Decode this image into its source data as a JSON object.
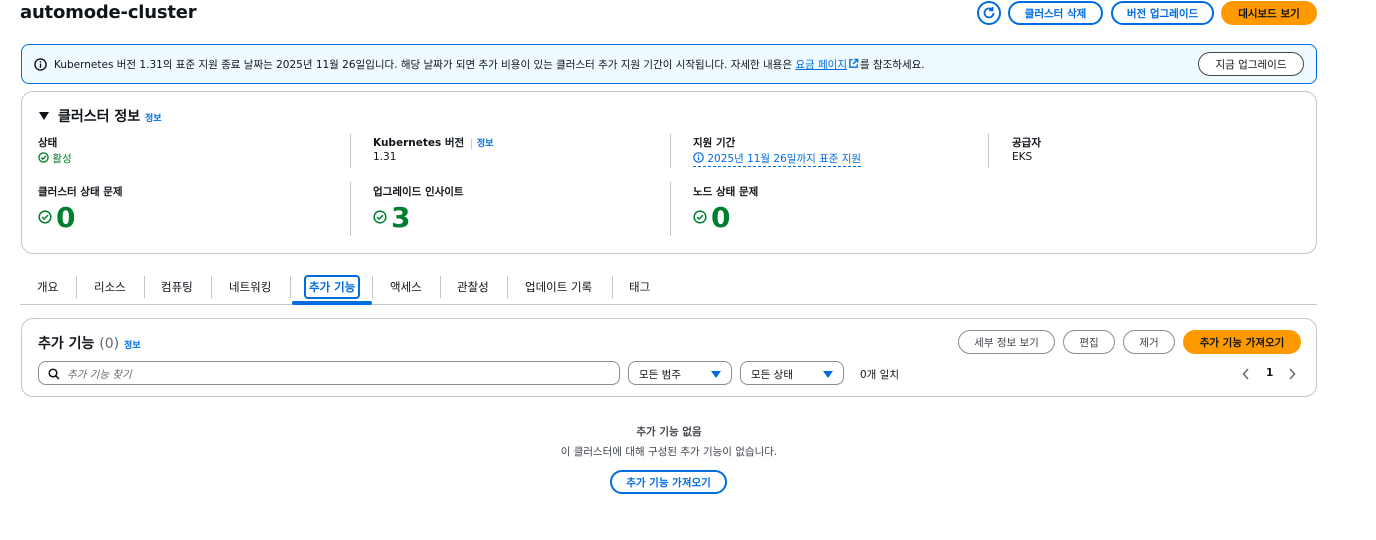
{
  "header": {
    "title": "automode-cluster",
    "delete_label": "클러스터 삭제",
    "upgrade_label": "버전 업그레이드",
    "dashboard_label": "대시보드 보기"
  },
  "alert": {
    "text_before": "Kubernetes 버전 1.31의 표준 지원 종료 날짜는 2025년 11월 26일입니다. 해당 날짜가 되면 추가 비용이 있는 클러스터 추가 지원 기간이 시작됩니다. 자세한 내용은 ",
    "link": "요금 페이지",
    "text_after": "를 참조하세요.",
    "button": "지금 업그레이드"
  },
  "cluster_info": {
    "title": "클러스터 정보",
    "info": "정보",
    "status_label": "상태",
    "status_value": "활성",
    "k8s_label": "Kubernetes 버전",
    "k8s_info": "정보",
    "k8s_value": "1.31",
    "support_label": "지원 기간",
    "support_value": "2025년 11월 26일까지 표준 지원",
    "provider_label": "공급자",
    "provider_value": "EKS",
    "health_label": "클러스터 상태 문제",
    "health_value": "0",
    "insights_label": "업그레이드 인사이트",
    "insights_value": "3",
    "node_label": "노드 상태 문제",
    "node_value": "0"
  },
  "tabs": [
    "개요",
    "리소스",
    "컴퓨팅",
    "네트워킹",
    "추가 기능",
    "액세스",
    "관찰성",
    "업데이트 기록",
    "태그"
  ],
  "addons": {
    "title": "추가 기능",
    "count": "(0)",
    "info": "정보",
    "details_btn": "세부 정보 보기",
    "edit_btn": "편집",
    "remove_btn": "제거",
    "get_btn": "추가 기능 가져오기",
    "search_placeholder": "추가 기능 찾기",
    "category_select": "모든 범주",
    "status_select": "모든 상태",
    "match": "0개 일치",
    "page": "1",
    "empty_title": "추가 기능 없음",
    "empty_desc": "이 클러스터에 대해 구성된 추가 기능이 없습니다.",
    "empty_btn": "추가 기능 가져오기"
  },
  "colors": {
    "accent": "#006ce0",
    "primary": "#ff9900",
    "success": "#00802f"
  }
}
